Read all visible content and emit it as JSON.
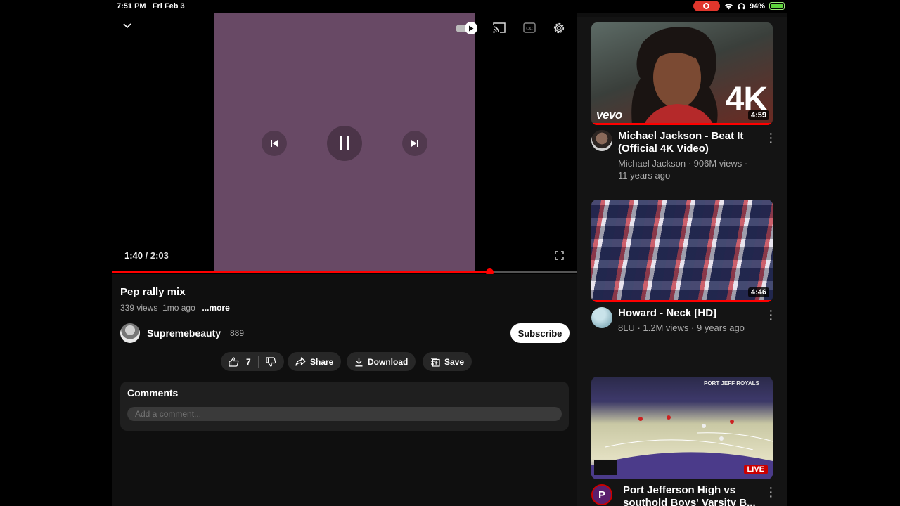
{
  "status_bar": {
    "time": "7:51 PM",
    "date": "Fri Feb 3",
    "battery": "94%"
  },
  "player": {
    "current_time": "1:40",
    "separator": " / ",
    "duration": "2:03",
    "progress": 0.813,
    "video_color": "#684965"
  },
  "video": {
    "title": "Pep rally mix",
    "views": "339 views",
    "age": "1mo ago",
    "more_label": "...more"
  },
  "channel": {
    "name": "Supremebeauty",
    "subscribers": "889",
    "subscribe_label": "Subscribe"
  },
  "actions": {
    "like_count": "7",
    "share_label": "Share",
    "download_label": "Download",
    "save_label": "Save"
  },
  "comments": {
    "title": "Comments",
    "placeholder": "Add a comment..."
  },
  "recommendations": [
    {
      "title": "Michael Jackson - Beat It\n(Official 4K Video)",
      "meta": "Michael Jackson · 906M views ·\n11 years ago",
      "duration": "4:59",
      "overlay_text": "4K",
      "brand_text": "vevo"
    },
    {
      "title": "Howard - Neck [HD]",
      "meta": "8LU · 1.2M views · 9 years ago",
      "duration": "4:46"
    },
    {
      "title": "Port Jefferson High vs\nsouthold Boys' Varsity B...",
      "live_label": "LIVE",
      "avatar_letter": "P",
      "banner_text": "PORT JEFF ROYALS"
    }
  ]
}
